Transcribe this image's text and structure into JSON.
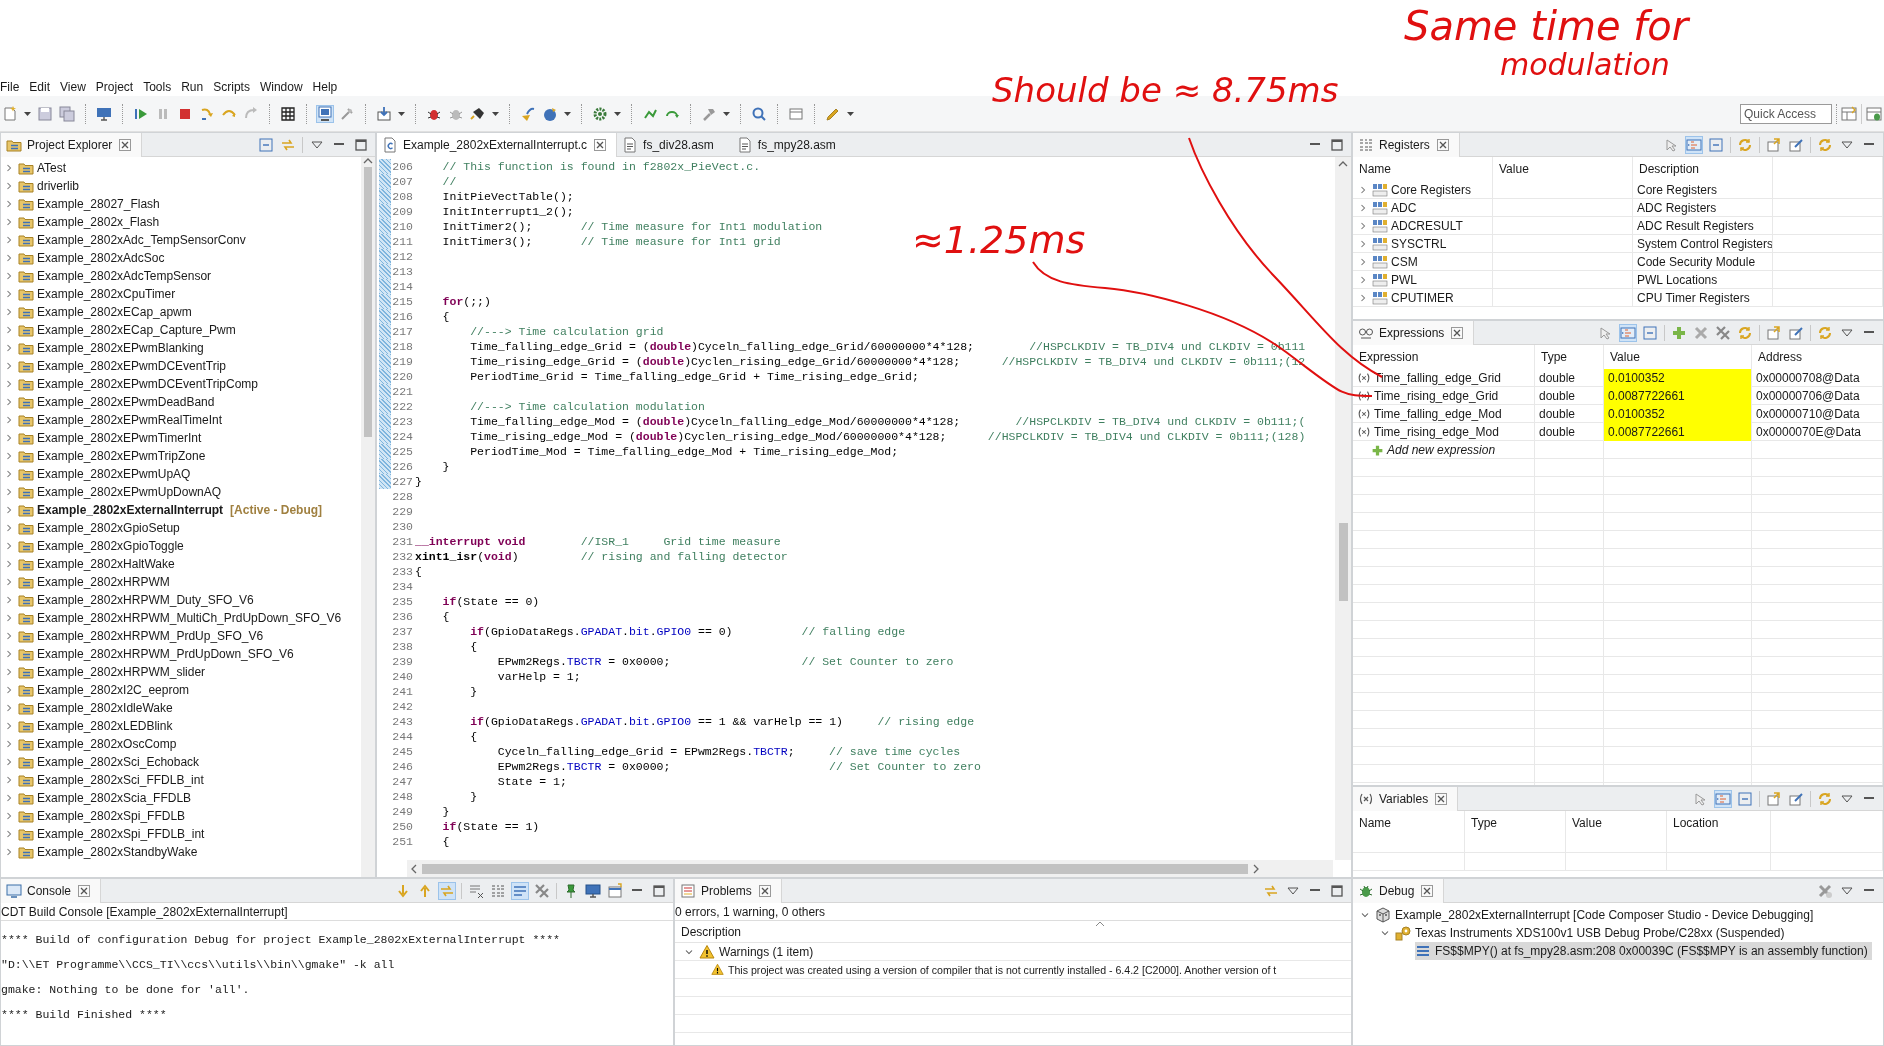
{
  "annotations": [
    {
      "text": "Same time for"
    },
    {
      "text": "modulation"
    },
    {
      "text": "Should be ≈ 8.75ms"
    },
    {
      "text": "≈1.25ms"
    }
  ],
  "menu": [
    "File",
    "Edit",
    "View",
    "Project",
    "Tools",
    "Run",
    "Scripts",
    "Window",
    "Help"
  ],
  "toolbar": {
    "quick_access": {
      "placeholder": "Quick Access"
    }
  },
  "project_explorer": {
    "title": "Project Explorer",
    "items": [
      {
        "name": "ATest",
        "expanded": false,
        "active": false
      },
      {
        "name": "driverlib",
        "expanded": false,
        "active": false
      },
      {
        "name": "Example_28027_Flash",
        "expanded": false,
        "active": false
      },
      {
        "name": "Example_2802x_Flash",
        "expanded": false,
        "active": false
      },
      {
        "name": "Example_2802xAdc_TempSensorConv",
        "expanded": false,
        "active": false
      },
      {
        "name": "Example_2802xAdcSoc",
        "expanded": false,
        "active": false
      },
      {
        "name": "Example_2802xAdcTempSensor",
        "expanded": false,
        "active": false
      },
      {
        "name": "Example_2802xCpuTimer",
        "expanded": false,
        "active": false
      },
      {
        "name": "Example_2802xECap_apwm",
        "expanded": false,
        "active": false
      },
      {
        "name": "Example_2802xECap_Capture_Pwm",
        "expanded": false,
        "active": false
      },
      {
        "name": "Example_2802xEPwmBlanking",
        "expanded": false,
        "active": false
      },
      {
        "name": "Example_2802xEPwmDCEventTrip",
        "expanded": false,
        "active": false
      },
      {
        "name": "Example_2802xEPwmDCEventTripComp",
        "expanded": false,
        "active": false
      },
      {
        "name": "Example_2802xEPwmDeadBand",
        "expanded": false,
        "active": false
      },
      {
        "name": "Example_2802xEPwmRealTimeInt",
        "expanded": false,
        "active": false
      },
      {
        "name": "Example_2802xEPwmTimerInt",
        "expanded": false,
        "active": false
      },
      {
        "name": "Example_2802xEPwmTripZone",
        "expanded": false,
        "active": false
      },
      {
        "name": "Example_2802xEPwmUpAQ",
        "expanded": false,
        "active": false
      },
      {
        "name": "Example_2802xEPwmUpDownAQ",
        "expanded": false,
        "active": false
      },
      {
        "name": "Example_2802xExternalInterrupt",
        "expanded": false,
        "active": true,
        "tag": "[Active - Debug]"
      },
      {
        "name": "Example_2802xGpioSetup",
        "expanded": false,
        "active": false
      },
      {
        "name": "Example_2802xGpioToggle",
        "expanded": false,
        "active": false
      },
      {
        "name": "Example_2802xHaltWake",
        "expanded": false,
        "active": false
      },
      {
        "name": "Example_2802xHRPWM",
        "expanded": false,
        "active": false
      },
      {
        "name": "Example_2802xHRPWM_Duty_SFO_V6",
        "expanded": false,
        "active": false
      },
      {
        "name": "Example_2802xHRPWM_MultiCh_PrdUpDown_SFO_V6",
        "expanded": false,
        "active": false
      },
      {
        "name": "Example_2802xHRPWM_PrdUp_SFO_V6",
        "expanded": false,
        "active": false
      },
      {
        "name": "Example_2802xHRPWM_PrdUpDown_SFO_V6",
        "expanded": false,
        "active": false
      },
      {
        "name": "Example_2802xHRPWM_slider",
        "expanded": false,
        "active": false
      },
      {
        "name": "Example_2802xI2C_eeprom",
        "expanded": false,
        "active": false
      },
      {
        "name": "Example_2802xIdleWake",
        "expanded": false,
        "active": false
      },
      {
        "name": "Example_2802xLEDBlink",
        "expanded": false,
        "active": false
      },
      {
        "name": "Example_2802xOscComp",
        "expanded": false,
        "active": false
      },
      {
        "name": "Example_2802xSci_Echoback",
        "expanded": false,
        "active": false
      },
      {
        "name": "Example_2802xSci_FFDLB_int",
        "expanded": false,
        "active": false
      },
      {
        "name": "Example_2802xScia_FFDLB",
        "expanded": false,
        "active": false
      },
      {
        "name": "Example_2802xSpi_FFDLB",
        "expanded": false,
        "active": false
      },
      {
        "name": "Example_2802xSpi_FFDLB_int",
        "expanded": false,
        "active": false
      },
      {
        "name": "Example_2802xStandbyWake",
        "expanded": false,
        "active": false
      }
    ]
  },
  "editor": {
    "tabs": [
      {
        "label": "Example_2802xExternalInterrupt.c",
        "selected": true,
        "kind": "c"
      },
      {
        "label": "fs_div28.asm",
        "selected": false,
        "kind": "asm"
      },
      {
        "label": "fs_mpy28.asm",
        "selected": false,
        "kind": "asm"
      }
    ],
    "lines": [
      {
        "no": "206",
        "changed": true,
        "tokens": [
          {
            "kind": "comment",
            "text": "    // This function is found in f2802x_PieVect.c."
          }
        ]
      },
      {
        "no": "207",
        "changed": true,
        "tokens": [
          {
            "kind": "comment",
            "text": "    //"
          }
        ]
      },
      {
        "no": "208",
        "changed": true,
        "tokens": [
          {
            "kind": "plain",
            "text": "    InitPieVectTable();"
          }
        ]
      },
      {
        "no": "209",
        "changed": true,
        "tokens": [
          {
            "kind": "plain",
            "text": "    InitInterrupt1_2();"
          }
        ]
      },
      {
        "no": "210",
        "changed": true,
        "tokens": [
          {
            "kind": "plain",
            "text": "    InitTimer2();       "
          },
          {
            "kind": "comment",
            "text": "// Time measure for Int1 modulation"
          }
        ]
      },
      {
        "no": "211",
        "changed": true,
        "tokens": [
          {
            "kind": "plain",
            "text": "    InitTimer3();       "
          },
          {
            "kind": "comment",
            "text": "// Time measure for Int1 grid"
          }
        ]
      },
      {
        "no": "212",
        "changed": true
      },
      {
        "no": "213",
        "changed": true
      },
      {
        "no": "214",
        "changed": true
      },
      {
        "no": "215",
        "changed": true,
        "tokens": [
          {
            "kind": "keyword",
            "text": "    for"
          },
          {
            "kind": "plain",
            "text": "(;;)"
          }
        ]
      },
      {
        "no": "216",
        "changed": true,
        "tokens": [
          {
            "kind": "plain",
            "text": "    {"
          }
        ]
      },
      {
        "no": "217",
        "changed": true,
        "tokens": [
          {
            "kind": "comment",
            "text": "        //---> Time calculation grid"
          }
        ]
      },
      {
        "no": "218",
        "changed": true,
        "tokens": [
          {
            "kind": "plain",
            "text": "        Time_falling_edge_Grid = ("
          },
          {
            "kind": "keyword",
            "text": "double"
          },
          {
            "kind": "plain",
            "text": ")Cyceln_falling_edge_Grid/60000000*4*128;        "
          },
          {
            "kind": "comment",
            "text": "//HSPCLKDIV = TB_DIV4 und CLKDIV = 0b111"
          }
        ]
      },
      {
        "no": "219",
        "changed": true,
        "tokens": [
          {
            "kind": "plain",
            "text": "        Time_rising_edge_Grid = ("
          },
          {
            "kind": "keyword",
            "text": "double"
          },
          {
            "kind": "plain",
            "text": ")Cyclen_rising_edge_Grid/60000000*4*128;      "
          },
          {
            "kind": "comment",
            "text": "//HSPCLKDIV = TB_DIV4 und CLKDIV = 0b111;(12"
          }
        ]
      },
      {
        "no": "220",
        "changed": true,
        "tokens": [
          {
            "kind": "plain",
            "text": "        PeriodTime_Grid = Time_falling_edge_Grid + Time_rising_edge_Grid;"
          }
        ]
      },
      {
        "no": "221",
        "changed": true
      },
      {
        "no": "222",
        "changed": true,
        "tokens": [
          {
            "kind": "comment",
            "text": "        //---> Time calculation modulation"
          }
        ]
      },
      {
        "no": "223",
        "changed": true,
        "tokens": [
          {
            "kind": "plain",
            "text": "        Time_falling_edge_Mod = ("
          },
          {
            "kind": "keyword",
            "text": "double"
          },
          {
            "kind": "plain",
            "text": ")Cyceln_falling_edge_Mod/60000000*4*128;        "
          },
          {
            "kind": "comment",
            "text": "//HSPCLKDIV = TB_DIV4 und CLKDIV = 0b111;("
          }
        ]
      },
      {
        "no": "224",
        "changed": true,
        "tokens": [
          {
            "kind": "plain",
            "text": "        Time_rising_edge_Mod = ("
          },
          {
            "kind": "keyword",
            "text": "double"
          },
          {
            "kind": "plain",
            "text": ")Cyclen_rising_edge_Mod/60000000*4*128;      "
          },
          {
            "kind": "comment",
            "text": "//HSPCLKDIV = TB_DIV4 und CLKDIV = 0b111;(128)"
          }
        ]
      },
      {
        "no": "225",
        "changed": true,
        "tokens": [
          {
            "kind": "plain",
            "text": "        PeriodTime_Mod = Time_falling_edge_Mod + Time_rising_edge_Mod;"
          }
        ]
      },
      {
        "no": "226",
        "changed": true,
        "tokens": [
          {
            "kind": "plain",
            "text": "    }"
          }
        ]
      },
      {
        "no": "227",
        "changed": true,
        "tokens": [
          {
            "kind": "plain",
            "text": "}"
          }
        ]
      },
      {
        "no": "228",
        "changed": false
      },
      {
        "no": "229",
        "changed": false
      },
      {
        "no": "230",
        "changed": false
      },
      {
        "no": "231",
        "changed": false,
        "tokens": [
          {
            "kind": "keyword",
            "text": "__interrupt void"
          },
          {
            "kind": "comment",
            "text": "        //ISR_1     Grid time measure"
          }
        ]
      },
      {
        "no": "232",
        "changed": false,
        "tokens": [
          {
            "kind": "function",
            "text": "xint1_isr"
          },
          {
            "kind": "plain",
            "text": "("
          },
          {
            "kind": "keyword",
            "text": "void"
          },
          {
            "kind": "plain",
            "text": ")         "
          },
          {
            "kind": "comment",
            "text": "// rising and falling detector"
          }
        ]
      },
      {
        "no": "233",
        "changed": false,
        "tokens": [
          {
            "kind": "plain",
            "text": "{"
          }
        ]
      },
      {
        "no": "234",
        "changed": false
      },
      {
        "no": "235",
        "changed": false,
        "tokens": [
          {
            "kind": "keyword",
            "text": "    if"
          },
          {
            "kind": "plain",
            "text": "(State == 0)"
          }
        ]
      },
      {
        "no": "236",
        "changed": false,
        "tokens": [
          {
            "kind": "plain",
            "text": "    {"
          }
        ]
      },
      {
        "no": "237",
        "changed": false,
        "tokens": [
          {
            "kind": "keyword",
            "text": "        if"
          },
          {
            "kind": "plain",
            "text": "(GpioDataRegs."
          },
          {
            "kind": "field",
            "text": "GPADAT"
          },
          {
            "kind": "plain",
            "text": "."
          },
          {
            "kind": "field",
            "text": "bit"
          },
          {
            "kind": "plain",
            "text": "."
          },
          {
            "kind": "field",
            "text": "GPIO0"
          },
          {
            "kind": "plain",
            "text": " == 0)          "
          },
          {
            "kind": "comment",
            "text": "// falling edge"
          }
        ]
      },
      {
        "no": "238",
        "changed": false,
        "tokens": [
          {
            "kind": "plain",
            "text": "        {"
          }
        ]
      },
      {
        "no": "239",
        "changed": false,
        "tokens": [
          {
            "kind": "plain",
            "text": "            EPwm2Regs."
          },
          {
            "kind": "field",
            "text": "TBCTR"
          },
          {
            "kind": "plain",
            "text": " = 0x0000;                   "
          },
          {
            "kind": "comment",
            "text": "// Set Counter to zero"
          }
        ]
      },
      {
        "no": "240",
        "changed": false,
        "tokens": [
          {
            "kind": "plain",
            "text": "            varHelp = 1;"
          }
        ]
      },
      {
        "no": "241",
        "changed": false,
        "tokens": [
          {
            "kind": "plain",
            "text": "        }"
          }
        ]
      },
      {
        "no": "242",
        "changed": false
      },
      {
        "no": "243",
        "changed": false,
        "tokens": [
          {
            "kind": "keyword",
            "text": "        if"
          },
          {
            "kind": "plain",
            "text": "(GpioDataRegs."
          },
          {
            "kind": "field",
            "text": "GPADAT"
          },
          {
            "kind": "plain",
            "text": "."
          },
          {
            "kind": "field",
            "text": "bit"
          },
          {
            "kind": "plain",
            "text": "."
          },
          {
            "kind": "field",
            "text": "GPIO0"
          },
          {
            "kind": "plain",
            "text": " == 1 && varHelp == 1)     "
          },
          {
            "kind": "comment",
            "text": "// rising edge"
          }
        ]
      },
      {
        "no": "244",
        "changed": false,
        "tokens": [
          {
            "kind": "plain",
            "text": "        {"
          }
        ]
      },
      {
        "no": "245",
        "changed": false,
        "tokens": [
          {
            "kind": "plain",
            "text": "            Cyceln_falling_edge_Grid = EPwm2Regs."
          },
          {
            "kind": "field",
            "text": "TBCTR"
          },
          {
            "kind": "plain",
            "text": ";     "
          },
          {
            "kind": "comment",
            "text": "// save time cycles"
          }
        ]
      },
      {
        "no": "246",
        "changed": false,
        "tokens": [
          {
            "kind": "plain",
            "text": "            EPwm2Regs."
          },
          {
            "kind": "field",
            "text": "TBCTR"
          },
          {
            "kind": "plain",
            "text": " = 0x0000;                       "
          },
          {
            "kind": "comment",
            "text": "// Set Counter to zero"
          }
        ]
      },
      {
        "no": "247",
        "changed": false,
        "tokens": [
          {
            "kind": "plain",
            "text": "            State = 1;"
          }
        ]
      },
      {
        "no": "248",
        "changed": false,
        "tokens": [
          {
            "kind": "plain",
            "text": "        }"
          }
        ]
      },
      {
        "no": "249",
        "changed": false,
        "tokens": [
          {
            "kind": "plain",
            "text": "    }"
          }
        ]
      },
      {
        "no": "250",
        "changed": false,
        "tokens": [
          {
            "kind": "keyword",
            "text": "    if"
          },
          {
            "kind": "plain",
            "text": "(State == 1)"
          }
        ]
      },
      {
        "no": "251",
        "changed": false,
        "tokens": [
          {
            "kind": "plain",
            "text": "    {"
          }
        ]
      }
    ]
  },
  "registers": {
    "title": "Registers",
    "columns": [
      "Name",
      "Value",
      "Description"
    ],
    "rows": [
      {
        "name": "Core Registers",
        "description": "Core Registers",
        "expanded": false
      },
      {
        "name": "ADC",
        "description": "ADC Registers",
        "expanded": false
      },
      {
        "name": "ADCRESULT",
        "description": "ADC Result Registers",
        "expanded": false
      },
      {
        "name": "SYSCTRL",
        "description": "System Control Registers",
        "expanded": false
      },
      {
        "name": "CSM",
        "description": "Code Security Module",
        "expanded": false
      },
      {
        "name": "PWL",
        "description": "PWL Locations",
        "expanded": false
      },
      {
        "name": "CPUTIMER",
        "description": "CPU Timer Registers",
        "expanded": false
      }
    ]
  },
  "expressions": {
    "title": "Expressions",
    "columns": [
      "Expression",
      "Type",
      "Value",
      "Address"
    ],
    "rows": [
      {
        "expression": "Time_falling_edge_Grid",
        "type": "double",
        "value": "0.0100352",
        "address": "0x00000708@Data",
        "changed": true
      },
      {
        "expression": "Time_rising_edge_Grid",
        "type": "double",
        "value": "0.0087722661",
        "address": "0x00000706@Data",
        "changed": true
      },
      {
        "expression": "Time_falling_edge_Mod",
        "type": "double",
        "value": "0.0100352",
        "address": "0x00000710@Data",
        "changed": true
      },
      {
        "expression": "Time_rising_edge_Mod",
        "type": "double",
        "value": "0.0087722661",
        "address": "0x0000070E@Data",
        "changed": true
      }
    ],
    "add_label": "Add new expression"
  },
  "variables": {
    "title": "Variables",
    "columns": [
      "Name",
      "Type",
      "Value",
      "Location"
    ]
  },
  "console": {
    "title": "Console",
    "subtitle": "CDT Build Console [Example_2802xExternalInterrupt]",
    "lines": [
      "**** Build of configuration Debug for project Example_2802xExternalInterrupt ****",
      "\"D:\\\\ET Programme\\\\CCS_TI\\\\ccs\\\\utils\\\\bin\\\\gmake\" -k all",
      "gmake: Nothing to be done for 'all'.",
      "**** Build Finished ****"
    ]
  },
  "problems": {
    "title": "Problems",
    "summary": "0 errors, 1 warning, 0 others",
    "columns": [
      "Description"
    ],
    "groups": [
      {
        "label": "Warnings (1 item)",
        "expanded": true,
        "items": [
          {
            "kind": "warning",
            "text": "This project was created using a version of compiler that is not currently installed - 6.4.2 [C2000]. Another version of t"
          }
        ]
      }
    ]
  },
  "debug": {
    "title": "Debug",
    "tree": [
      {
        "kind": "session",
        "label": "Example_2802xExternalInterrupt [Code Composer Studio - Device Debugging]",
        "expanded": true,
        "selected": false,
        "children": [
          {
            "kind": "target",
            "label": "Texas Instruments XDS100v1 USB Debug Probe/C28xx (Suspended)",
            "expanded": true,
            "selected": false,
            "children": [
              {
                "kind": "frame",
                "label": "FS$$MPY() at fs_mpy28.asm:208 0x00039C  (FS$$MPY is an assembly function)",
                "selected": true
              }
            ]
          }
        ]
      }
    ]
  }
}
